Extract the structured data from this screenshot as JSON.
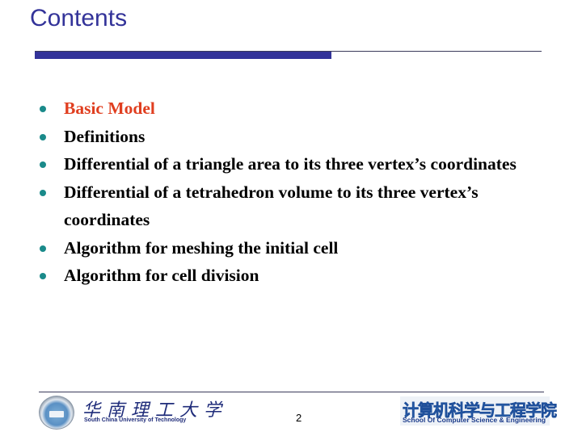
{
  "slide": {
    "title": "Contents",
    "page_number": "2"
  },
  "colors": {
    "title": "#333399",
    "accent_bar": "#333399",
    "active_item": "#e03e1f",
    "bullet": "#1a8a8a",
    "body_text": "#000000"
  },
  "bullets": [
    {
      "text": "Basic Model",
      "active": true,
      "icon": "bullet-dot-icon"
    },
    {
      "text": "Definitions",
      "active": false,
      "icon": "bullet-dot-icon"
    },
    {
      "text": "Differential of a triangle area to its three vertex’s coordinates",
      "active": false,
      "icon": "bullet-dot-icon"
    },
    {
      "text": "Differential of a tetrahedron volume to its three vertex’s coordinates",
      "active": false,
      "icon": "bullet-dot-icon"
    },
    {
      "text": "Algorithm for meshing the initial cell",
      "active": false,
      "icon": "bullet-dot-icon"
    },
    {
      "text": "Algorithm for cell division",
      "active": false,
      "icon": "bullet-dot-icon"
    }
  ],
  "footer": {
    "university_logo": {
      "icon": "university-seal-icon",
      "name_cn": "华南理工大学",
      "name_en": "South China University of Technology"
    },
    "school_logo": {
      "name_cn": "计算机科学与工程学院",
      "name_en": "School Of Computer Science & Engineering"
    }
  }
}
